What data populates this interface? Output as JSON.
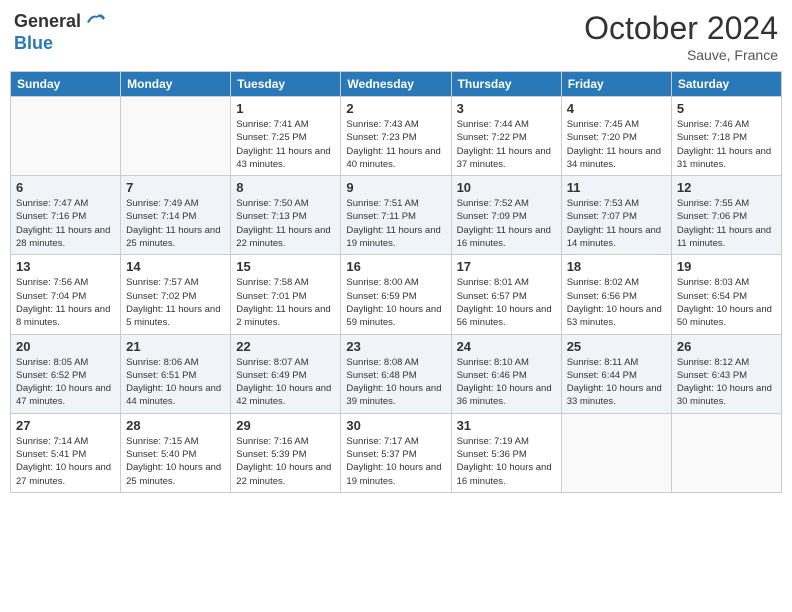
{
  "header": {
    "logo_line1": "General",
    "logo_line2": "Blue",
    "month": "October 2024",
    "location": "Sauve, France"
  },
  "weekdays": [
    "Sunday",
    "Monday",
    "Tuesday",
    "Wednesday",
    "Thursday",
    "Friday",
    "Saturday"
  ],
  "weeks": [
    [
      {
        "day": "",
        "info": ""
      },
      {
        "day": "",
        "info": ""
      },
      {
        "day": "1",
        "info": "Sunrise: 7:41 AM\nSunset: 7:25 PM\nDaylight: 11 hours and 43 minutes."
      },
      {
        "day": "2",
        "info": "Sunrise: 7:43 AM\nSunset: 7:23 PM\nDaylight: 11 hours and 40 minutes."
      },
      {
        "day": "3",
        "info": "Sunrise: 7:44 AM\nSunset: 7:22 PM\nDaylight: 11 hours and 37 minutes."
      },
      {
        "day": "4",
        "info": "Sunrise: 7:45 AM\nSunset: 7:20 PM\nDaylight: 11 hours and 34 minutes."
      },
      {
        "day": "5",
        "info": "Sunrise: 7:46 AM\nSunset: 7:18 PM\nDaylight: 11 hours and 31 minutes."
      }
    ],
    [
      {
        "day": "6",
        "info": "Sunrise: 7:47 AM\nSunset: 7:16 PM\nDaylight: 11 hours and 28 minutes."
      },
      {
        "day": "7",
        "info": "Sunrise: 7:49 AM\nSunset: 7:14 PM\nDaylight: 11 hours and 25 minutes."
      },
      {
        "day": "8",
        "info": "Sunrise: 7:50 AM\nSunset: 7:13 PM\nDaylight: 11 hours and 22 minutes."
      },
      {
        "day": "9",
        "info": "Sunrise: 7:51 AM\nSunset: 7:11 PM\nDaylight: 11 hours and 19 minutes."
      },
      {
        "day": "10",
        "info": "Sunrise: 7:52 AM\nSunset: 7:09 PM\nDaylight: 11 hours and 16 minutes."
      },
      {
        "day": "11",
        "info": "Sunrise: 7:53 AM\nSunset: 7:07 PM\nDaylight: 11 hours and 14 minutes."
      },
      {
        "day": "12",
        "info": "Sunrise: 7:55 AM\nSunset: 7:06 PM\nDaylight: 11 hours and 11 minutes."
      }
    ],
    [
      {
        "day": "13",
        "info": "Sunrise: 7:56 AM\nSunset: 7:04 PM\nDaylight: 11 hours and 8 minutes."
      },
      {
        "day": "14",
        "info": "Sunrise: 7:57 AM\nSunset: 7:02 PM\nDaylight: 11 hours and 5 minutes."
      },
      {
        "day": "15",
        "info": "Sunrise: 7:58 AM\nSunset: 7:01 PM\nDaylight: 11 hours and 2 minutes."
      },
      {
        "day": "16",
        "info": "Sunrise: 8:00 AM\nSunset: 6:59 PM\nDaylight: 10 hours and 59 minutes."
      },
      {
        "day": "17",
        "info": "Sunrise: 8:01 AM\nSunset: 6:57 PM\nDaylight: 10 hours and 56 minutes."
      },
      {
        "day": "18",
        "info": "Sunrise: 8:02 AM\nSunset: 6:56 PM\nDaylight: 10 hours and 53 minutes."
      },
      {
        "day": "19",
        "info": "Sunrise: 8:03 AM\nSunset: 6:54 PM\nDaylight: 10 hours and 50 minutes."
      }
    ],
    [
      {
        "day": "20",
        "info": "Sunrise: 8:05 AM\nSunset: 6:52 PM\nDaylight: 10 hours and 47 minutes."
      },
      {
        "day": "21",
        "info": "Sunrise: 8:06 AM\nSunset: 6:51 PM\nDaylight: 10 hours and 44 minutes."
      },
      {
        "day": "22",
        "info": "Sunrise: 8:07 AM\nSunset: 6:49 PM\nDaylight: 10 hours and 42 minutes."
      },
      {
        "day": "23",
        "info": "Sunrise: 8:08 AM\nSunset: 6:48 PM\nDaylight: 10 hours and 39 minutes."
      },
      {
        "day": "24",
        "info": "Sunrise: 8:10 AM\nSunset: 6:46 PM\nDaylight: 10 hours and 36 minutes."
      },
      {
        "day": "25",
        "info": "Sunrise: 8:11 AM\nSunset: 6:44 PM\nDaylight: 10 hours and 33 minutes."
      },
      {
        "day": "26",
        "info": "Sunrise: 8:12 AM\nSunset: 6:43 PM\nDaylight: 10 hours and 30 minutes."
      }
    ],
    [
      {
        "day": "27",
        "info": "Sunrise: 7:14 AM\nSunset: 5:41 PM\nDaylight: 10 hours and 27 minutes."
      },
      {
        "day": "28",
        "info": "Sunrise: 7:15 AM\nSunset: 5:40 PM\nDaylight: 10 hours and 25 minutes."
      },
      {
        "day": "29",
        "info": "Sunrise: 7:16 AM\nSunset: 5:39 PM\nDaylight: 10 hours and 22 minutes."
      },
      {
        "day": "30",
        "info": "Sunrise: 7:17 AM\nSunset: 5:37 PM\nDaylight: 10 hours and 19 minutes."
      },
      {
        "day": "31",
        "info": "Sunrise: 7:19 AM\nSunset: 5:36 PM\nDaylight: 10 hours and 16 minutes."
      },
      {
        "day": "",
        "info": ""
      },
      {
        "day": "",
        "info": ""
      }
    ]
  ]
}
